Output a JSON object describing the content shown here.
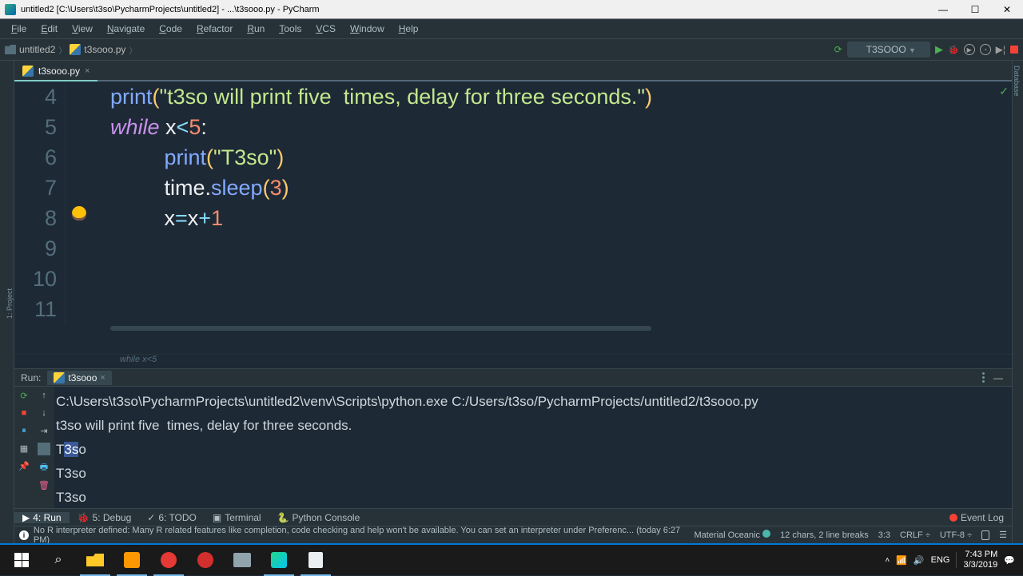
{
  "window": {
    "title": "untitled2 [C:\\Users\\t3so\\PycharmProjects\\untitled2] - ...\\t3sooo.py - PyCharm"
  },
  "menu": [
    "File",
    "Edit",
    "View",
    "Navigate",
    "Code",
    "Refactor",
    "Run",
    "Tools",
    "VCS",
    "Window",
    "Help"
  ],
  "breadcrumb": {
    "project": "untitled2",
    "file": "t3sooo.py"
  },
  "run_config": "T3SOOO",
  "editor": {
    "tab": "t3sooo.py",
    "context": "while x<5",
    "lines": [
      {
        "num": 4,
        "html": "<span class='fn'>print</span><span class='paren'>(</span><span class='str'>\"t3so will print five  times, delay for three seconds.\"</span><span class='paren'>)</span>"
      },
      {
        "num": 5,
        "html": "<span class='kw'>while</span> x<span class='op'>&lt;</span><span class='num'>5</span>:"
      },
      {
        "num": 6,
        "html": "         <span class='fn'>print</span><span class='paren'>(</span><span class='str'>\"T3so\"</span><span class='paren'>)</span>"
      },
      {
        "num": 7,
        "html": "         time.<span class='fn'>sleep</span><span class='paren'>(</span><span class='num'>3</span><span class='paren'>)</span>"
      },
      {
        "num": 8,
        "html": "         x<span class='op'>=</span>x<span class='op'>+</span><span class='num'>1</span>"
      },
      {
        "num": 9,
        "html": ""
      },
      {
        "num": 10,
        "html": ""
      },
      {
        "num": 11,
        "html": ""
      }
    ]
  },
  "run_panel": {
    "title": "Run:",
    "tab": "t3sooo",
    "output": [
      "C:\\Users\\t3so\\PycharmProjects\\untitled2\\venv\\Scripts\\python.exe C:/Users/t3so/PycharmProjects/untitled2/t3sooo.py",
      "t3so will print five  times, delay for three seconds.",
      "T3so",
      "T3so",
      "T3so"
    ],
    "selected_line_index": 2
  },
  "bottom_tabs": [
    {
      "key": "run",
      "label": "4: Run",
      "active": true,
      "icon": "▶"
    },
    {
      "key": "debug",
      "label": "5: Debug",
      "icon": "🐞"
    },
    {
      "key": "todo",
      "label": "6: TODO",
      "icon": "✓"
    },
    {
      "key": "terminal",
      "label": "Terminal",
      "icon": "▣"
    },
    {
      "key": "pycon",
      "label": "Python Console",
      "icon": "🐍"
    }
  ],
  "event_log": "Event Log",
  "status": {
    "msg": "No R interpreter defined: Many R related features like completion, code checking and help won't be available. You can set an interpreter under Preferenc... (today 6:27 PM)",
    "theme": "Material Oceanic",
    "sel": "12 chars, 2 line breaks",
    "pos": "3:3",
    "crlf": "CRLF",
    "enc": "UTF-8"
  },
  "systray": {
    "lang": "ENG",
    "time": "7:43 PM",
    "date": "3/3/2019"
  }
}
